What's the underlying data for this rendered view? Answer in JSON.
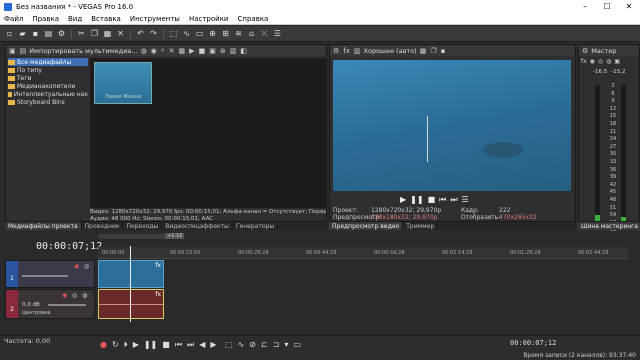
{
  "window": {
    "title": "Без названия * - VEGAS Pro 16.0",
    "minimize": "–",
    "maximize": "☐",
    "close": "✕"
  },
  "menu": [
    "Файл",
    "Правка",
    "Вид",
    "Вставка",
    "Инструменты",
    "Настройки",
    "Справка"
  ],
  "media_panel": {
    "import_label": "Импортировать мультимедиа...",
    "tree": [
      "Все медиафайлы",
      "По типу",
      "Теги",
      "Медианакопители",
      "Интеллектуальные нак",
      "Storyboard Bins"
    ],
    "thumb_label": "Линия Жизни",
    "info_line1": "Видео: 1280x720x32; 29,970 fps; 00:00:15;01; Альфа-канал = Отсутствует; Порядок полей",
    "info_line2": "Аудио: 48 000 Hz; Stereo; 00:00:15;01; AAC",
    "tabs": [
      "Медиафайлы проекта",
      "Проводник",
      "Переходы",
      "Видеоспецэффекты",
      "Генераторы"
    ]
  },
  "preview": {
    "quality": "Хорошее (авто)",
    "project_k": "Проект:",
    "project_v": "1280x720x32; 29,970p",
    "frame_k": "Кадр:",
    "frame_v": "222",
    "prerender_k": "Предпросмотр:",
    "prerender_v": "320x180x32; 29,970p",
    "display_k": "Отобразить:",
    "display_v": "470x265x32",
    "tabs": [
      "Предпросмотр видео",
      "Триммер"
    ]
  },
  "master": {
    "title": "Мастер",
    "left_level": "-16,5",
    "right_level": "-15,2",
    "scale": [
      "3",
      "6",
      "9",
      "12",
      "15",
      "18",
      "21",
      "24",
      "27",
      "30",
      "33",
      "36",
      "39",
      "42",
      "45",
      "48",
      "51",
      "54",
      "57",
      "60"
    ],
    "tab": "Шина мастеринга",
    "vu_left": 0.07,
    "vu_right": 0.06
  },
  "timeline": {
    "timecode": "00:00:07;12",
    "ruler": [
      "00:00:00",
      "00:00:15;00",
      "00:00:29;29",
      "00:00:44;29",
      "00:00:59;28",
      "00:01:14;29",
      "00:01:29;29",
      "00:01:44;29"
    ],
    "video_track_num": "1",
    "audio_track_num": "2",
    "audio_vol": "0,0 dB",
    "audio_pan": "Центровка",
    "marker": "+1:10"
  },
  "bottom": {
    "rate": "Частота: 0,00",
    "timecode": "00:00:07;12",
    "status": "Время записи (2 каналов): 93:37:40"
  }
}
